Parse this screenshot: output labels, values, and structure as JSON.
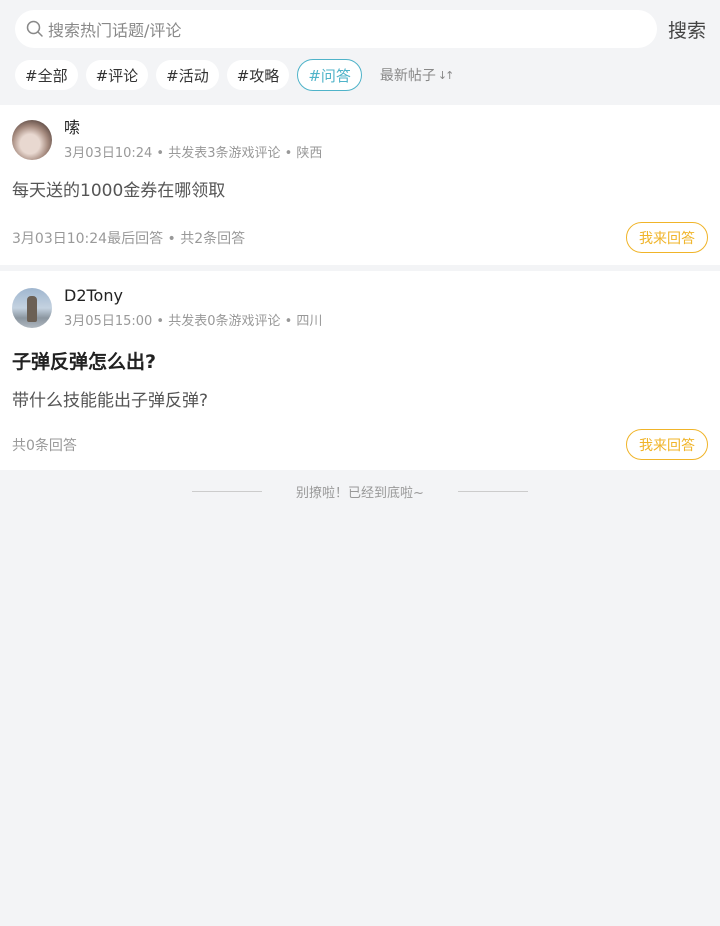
{
  "search": {
    "placeholder": "搜索热门话题/评论",
    "button_label": "搜索"
  },
  "tags": [
    {
      "label": "#全部",
      "active": false
    },
    {
      "label": "#评论",
      "active": false
    },
    {
      "label": "#活动",
      "active": false
    },
    {
      "label": "#攻略",
      "active": false
    },
    {
      "label": "#问答",
      "active": true
    }
  ],
  "sort": {
    "label": "最新帖子",
    "icon": "sort-arrows-icon"
  },
  "posts": [
    {
      "username": "嗦",
      "meta": "3月03日10:24 • 共发表3条游戏评论 • 陕西",
      "title": "",
      "body": "每天送的1000金券在哪领取",
      "footer": "3月03日10:24最后回答 • 共2条回答",
      "answer_label": "我来回答"
    },
    {
      "username": "D2Tony",
      "meta": "3月05日15:00 • 共发表0条游戏评论 • 四川",
      "title": "子弹反弹怎么出?",
      "body": "带什么技能能出子弹反弹?",
      "footer": "共0条回答",
      "answer_label": "我来回答"
    }
  ],
  "end_text": "别撩啦！已经到底啦~",
  "colors": {
    "accent_teal": "#4fb3c9",
    "accent_gold": "#f0b429",
    "background": "#f3f4f6"
  }
}
